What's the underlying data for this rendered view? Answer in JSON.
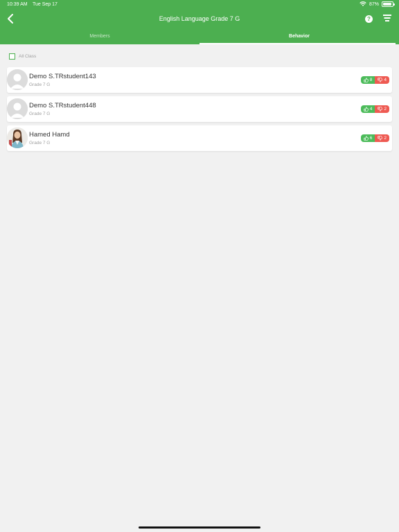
{
  "status": {
    "time": "10:39 AM",
    "date": "Tue Sep 17",
    "battery": "87%"
  },
  "header": {
    "title": "English Language Grade 7 G",
    "help_label": "?"
  },
  "tabs": [
    {
      "label": "Members",
      "active": false
    },
    {
      "label": "Behavior",
      "active": true
    }
  ],
  "filter": {
    "all_class_label": "All Class",
    "checked": false
  },
  "students": [
    {
      "name": "Demo S.TRstudent143",
      "grade": "Grade 7 G",
      "positive": "8",
      "negative": "4"
    },
    {
      "name": "Demo S.TRstudent448",
      "grade": "Grade 7 G",
      "positive": "4",
      "negative": "2"
    },
    {
      "name": "Hamed Hamd",
      "grade": "Grade 7 G",
      "positive": "6",
      "negative": "2"
    }
  ],
  "colors": {
    "brand_green": "#4caf50",
    "positive": "#4cbb5a",
    "negative": "#ee5a52"
  },
  "icons": [
    "chevron-left-icon",
    "help-icon",
    "menu-icon",
    "thumbs-up-icon",
    "thumbs-down-icon",
    "wifi-icon",
    "battery-icon"
  ]
}
